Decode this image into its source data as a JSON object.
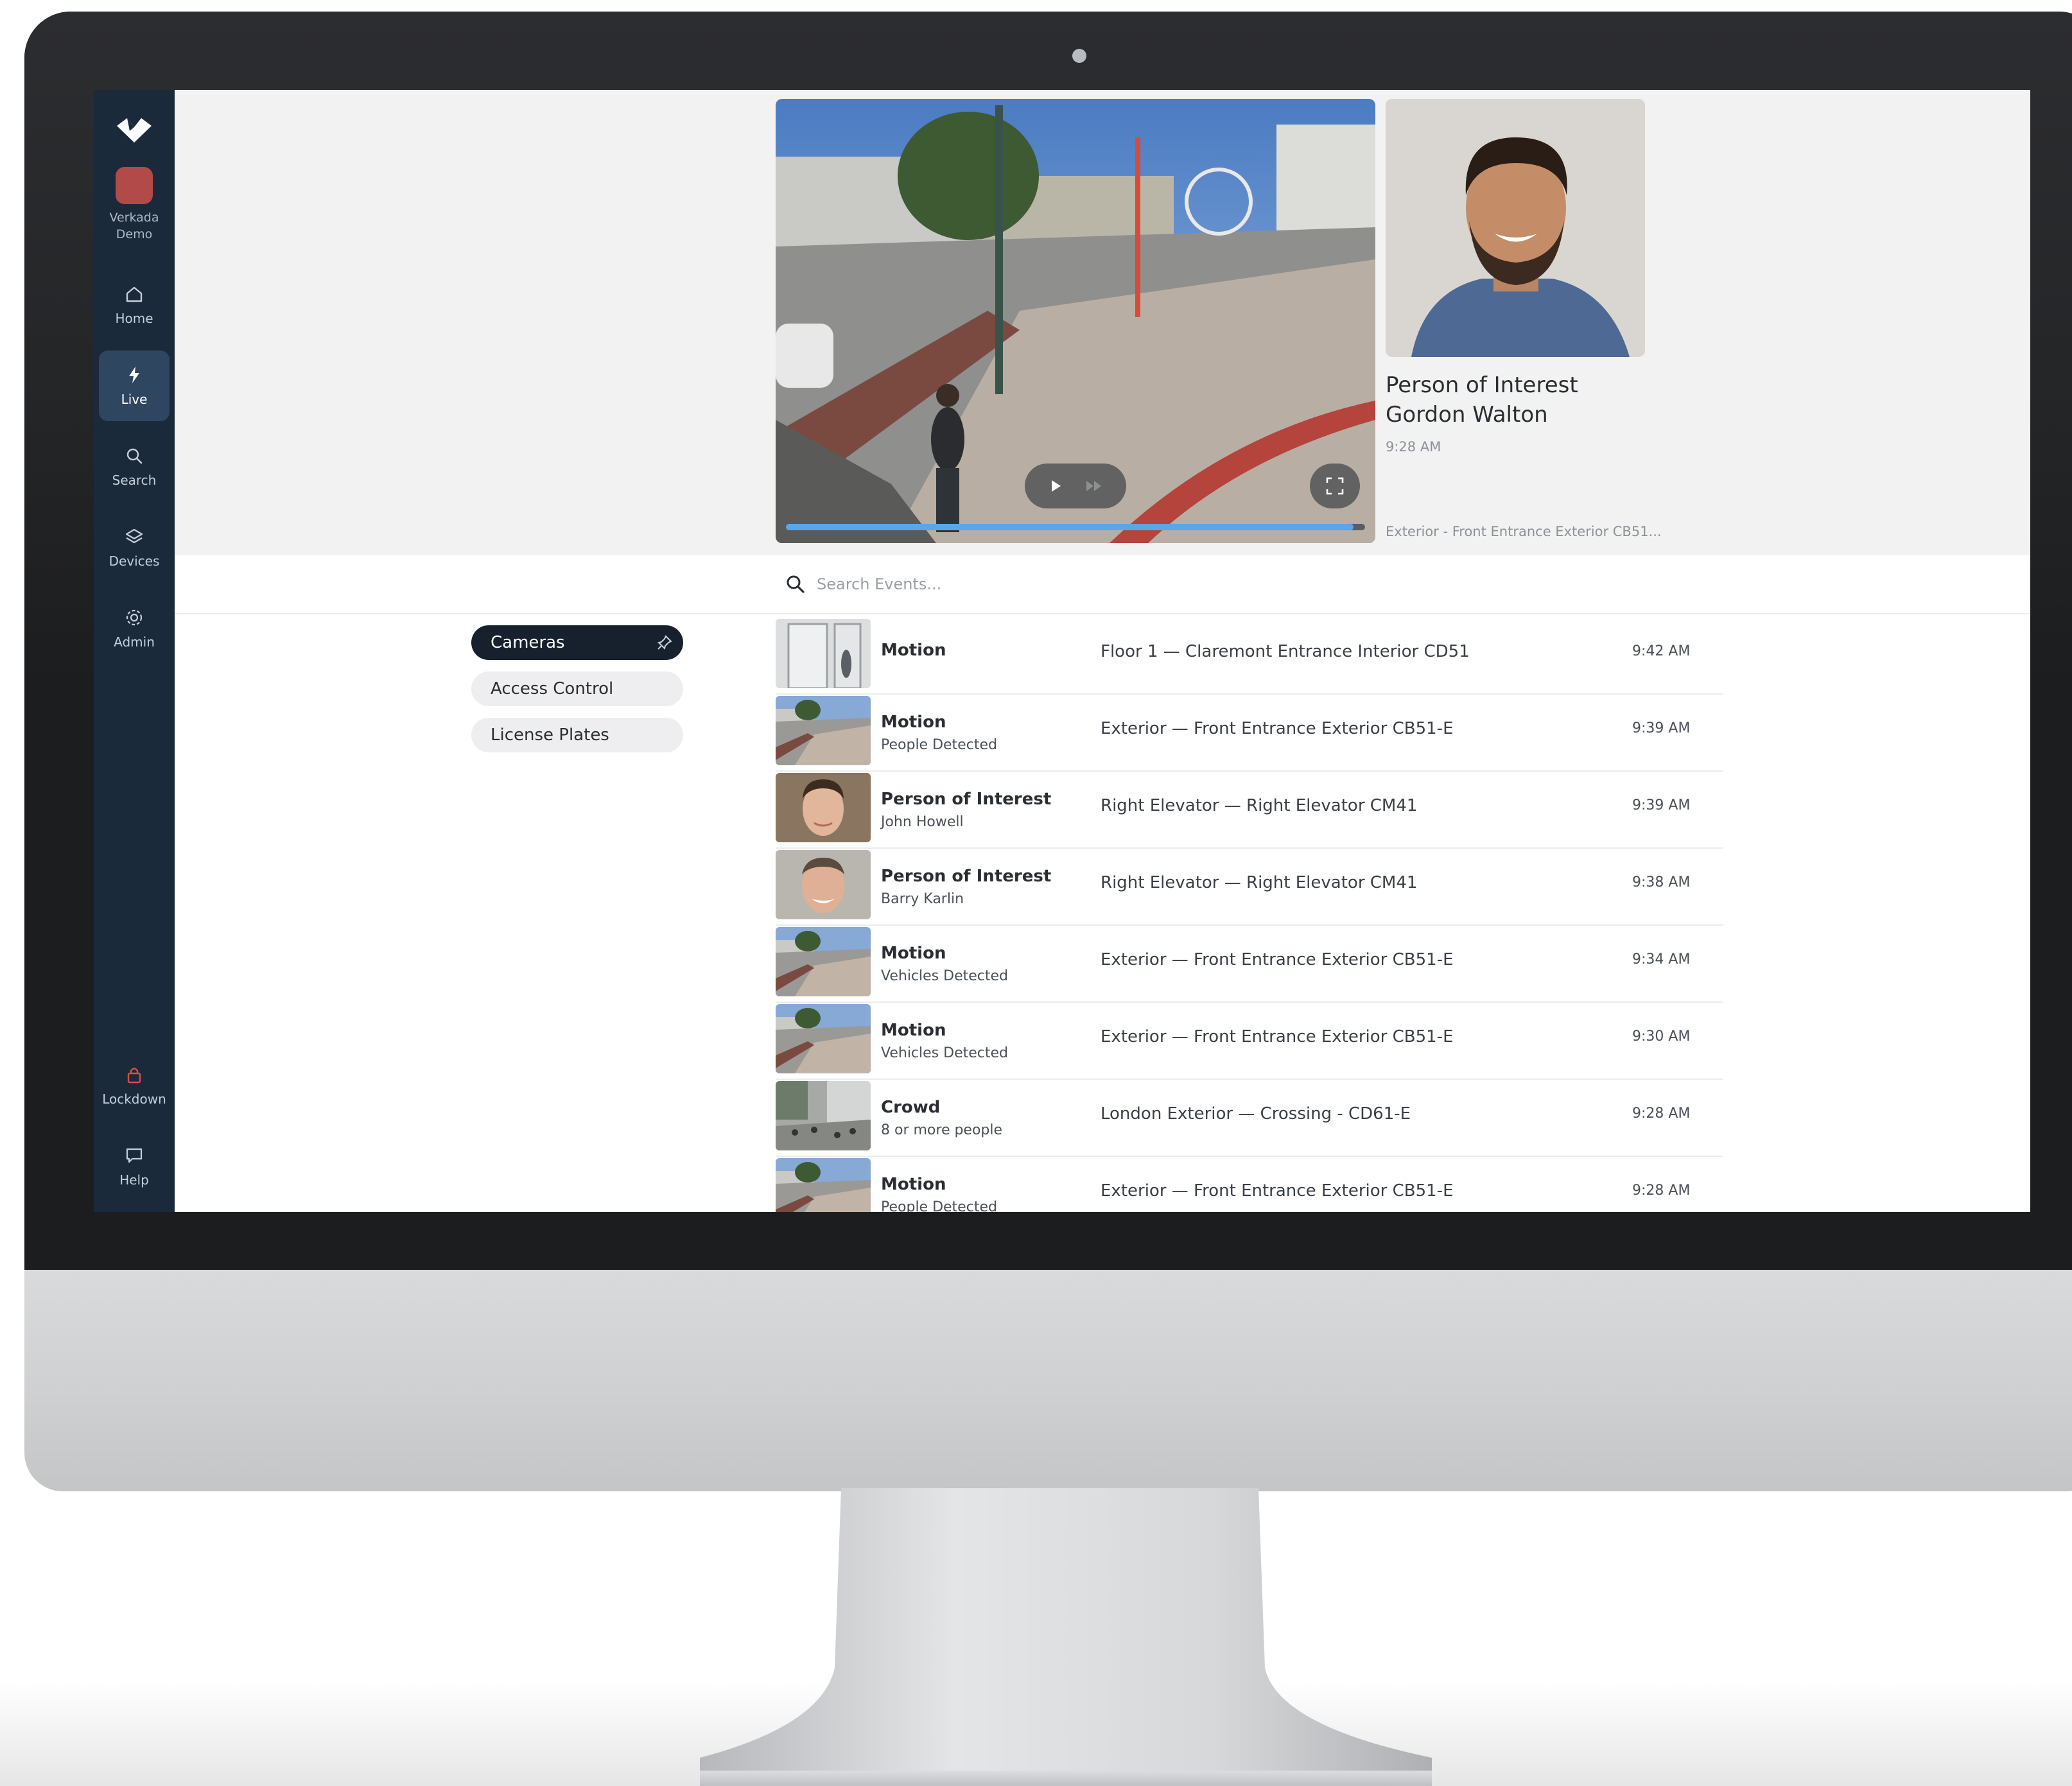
{
  "sidebar": {
    "org_name": "Verkada Demo",
    "items": [
      {
        "label": "Home",
        "icon": "home-icon"
      },
      {
        "label": "Live",
        "icon": "lightning-icon",
        "active": true
      },
      {
        "label": "Search",
        "icon": "search-icon"
      },
      {
        "label": "Devices",
        "icon": "layers-icon"
      },
      {
        "label": "Admin",
        "icon": "gear-icon"
      }
    ],
    "bottom_items": [
      {
        "label": "Lockdown",
        "icon": "lock-icon",
        "color": "#e0494b"
      },
      {
        "label": "Help",
        "icon": "chat-icon"
      }
    ]
  },
  "featured_event": {
    "title": "Person of Interest",
    "name": "Gordon Walton",
    "time": "9:28 AM",
    "camera": "Exterior - Front Entrance Exterior CB51...",
    "playback_progress": 0.98
  },
  "search": {
    "placeholder": "Search Events..."
  },
  "filters": [
    {
      "label": "Cameras",
      "active": true
    },
    {
      "label": "Access Control",
      "active": false
    },
    {
      "label": "License Plates",
      "active": false
    }
  ],
  "events": [
    {
      "type": "Motion",
      "sub": "",
      "location": "Floor 1 — Claremont Entrance Interior CD51",
      "time": "9:42 AM",
      "thumb": "interior"
    },
    {
      "type": "Motion",
      "sub": "People Detected",
      "location": "Exterior — Front Entrance Exterior CB51-E",
      "time": "9:39 AM",
      "thumb": "street"
    },
    {
      "type": "Person of Interest",
      "sub": "John Howell",
      "location": "Right Elevator — Right Elevator CM41",
      "time": "9:39 AM",
      "thumb": "face"
    },
    {
      "type": "Person of Interest",
      "sub": "Barry Karlin",
      "location": "Right Elevator — Right Elevator CM41",
      "time": "9:38 AM",
      "thumb": "face"
    },
    {
      "type": "Motion",
      "sub": "Vehicles Detected",
      "location": "Exterior — Front Entrance Exterior CB51-E",
      "time": "9:34 AM",
      "thumb": "street"
    },
    {
      "type": "Motion",
      "sub": "Vehicles Detected",
      "location": "Exterior — Front Entrance Exterior CB51-E",
      "time": "9:30 AM",
      "thumb": "street"
    },
    {
      "type": "Crowd",
      "sub": "8 or more people",
      "location": "London Exterior — Crossing - CD61-E",
      "time": "9:28 AM",
      "thumb": "crowd"
    },
    {
      "type": "Motion",
      "sub": "People Detected",
      "location": "Exterior — Front Entrance Exterior CB51-E",
      "time": "9:28 AM",
      "thumb": "street"
    }
  ],
  "colors": {
    "sidebar_bg": "#1b2a3a",
    "active_nav_bg": "#2f4660",
    "accent_progress": "#5aa6e8",
    "lockdown": "#e0494b"
  }
}
